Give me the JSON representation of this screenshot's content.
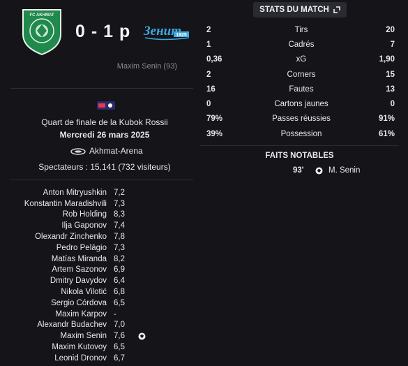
{
  "match": {
    "score": "0 - 1 p",
    "home_badge_text": "FC AKHMAT",
    "away_badge_text": "Зенит",
    "away_badge_year": "1925",
    "scorer_line": "Maxim Senin (93)"
  },
  "info": {
    "competition": "Quart de finale de la Kubok Rossii",
    "date": "Mercredi 26 mars 2025",
    "venue": "Akhmat-Arena",
    "attendance": "Spectateurs : 15,141 (732 visiteurs)"
  },
  "players": [
    {
      "name": "Anton Mitryushkin",
      "rating": "7,2",
      "event": ""
    },
    {
      "name": "Konstantin Maradishvili",
      "rating": "7,3",
      "event": ""
    },
    {
      "name": "Rob Holding",
      "rating": "8,3",
      "event": ""
    },
    {
      "name": "Ilja Gaponov",
      "rating": "7,4",
      "event": ""
    },
    {
      "name": "Olexandr Zinchenko",
      "rating": "7,8",
      "event": ""
    },
    {
      "name": "Pedro Pelágio",
      "rating": "7,3",
      "event": ""
    },
    {
      "name": "Matías Miranda",
      "rating": "8,2",
      "event": ""
    },
    {
      "name": "Artem Sazonov",
      "rating": "6,9",
      "event": ""
    },
    {
      "name": "Dmitry Davydov",
      "rating": "6,4",
      "event": ""
    },
    {
      "name": "Nikola Vilotić",
      "rating": "6,8",
      "event": ""
    },
    {
      "name": "Sergio Córdova",
      "rating": "6,5",
      "event": ""
    },
    {
      "name": "Maxim Karpov",
      "rating": "-",
      "event": ""
    },
    {
      "name": "Alexandr Budachev",
      "rating": "7,0",
      "event": ""
    },
    {
      "name": "Maxim Senin",
      "rating": "7,6",
      "event": "goal-icon"
    },
    {
      "name": "Maxim Kutovoy",
      "rating": "6,5",
      "event": ""
    },
    {
      "name": "Leonid Dronov",
      "rating": "6,7",
      "event": ""
    }
  ],
  "stats": {
    "header": "STATS DU MATCH",
    "rows": [
      {
        "home": "2",
        "label": "Tirs",
        "away": "20"
      },
      {
        "home": "1",
        "label": "Cadrés",
        "away": "7"
      },
      {
        "home": "0,36",
        "label": "xG",
        "away": "1,90"
      },
      {
        "home": "2",
        "label": "Corners",
        "away": "15"
      },
      {
        "home": "16",
        "label": "Fautes",
        "away": "13"
      },
      {
        "home": "0",
        "label": "Cartons jaunes",
        "away": "0"
      },
      {
        "home": "79%",
        "label": "Passes réussies",
        "away": "91%"
      },
      {
        "home": "39%",
        "label": "Possession",
        "away": "61%"
      }
    ]
  },
  "notable": {
    "title": "FAITS NOTABLES",
    "events": [
      {
        "minute": "93'",
        "icon": "goal-icon",
        "player": "M. Senin"
      }
    ]
  },
  "colors": {
    "background": "#141419",
    "home_green": "#1f8a4c",
    "away_blue": "#3fa9e0"
  }
}
